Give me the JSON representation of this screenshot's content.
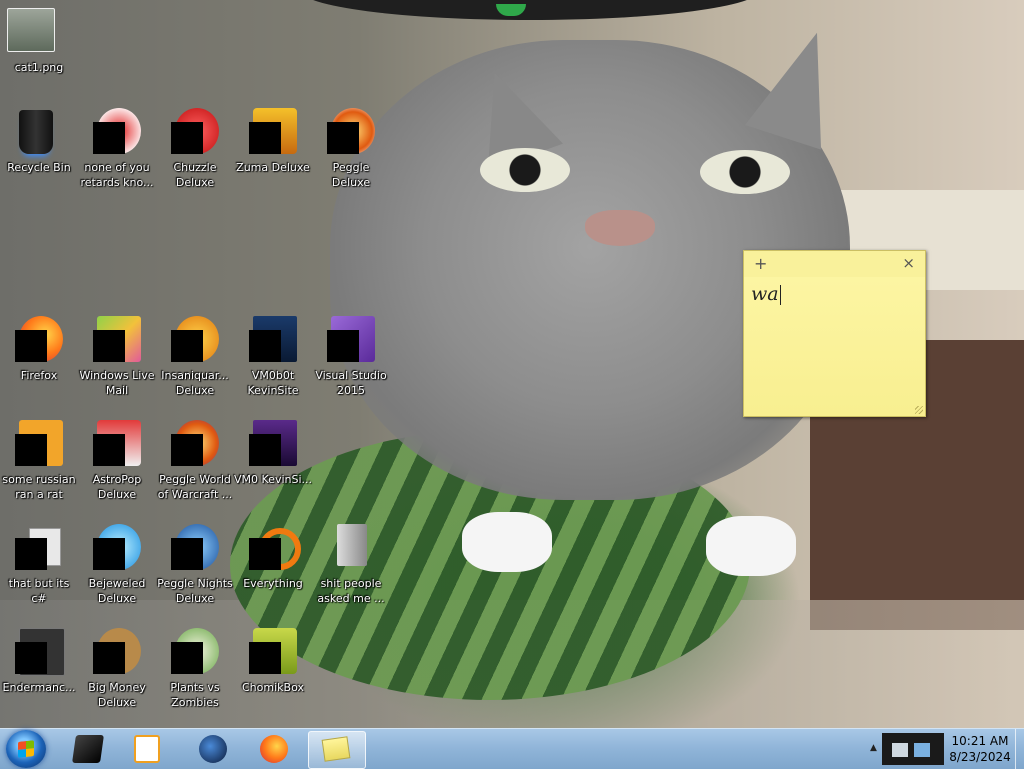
{
  "desktop": {
    "icons": [
      {
        "label": "cat1.png",
        "name": "desktop-icon-cat1"
      },
      {
        "label": "Recycle Bin",
        "name": "desktop-icon-recycle-bin"
      },
      {
        "label": "none of you retards kno...",
        "name": "desktop-icon-none-of-you"
      },
      {
        "label": "Chuzzle Deluxe",
        "name": "desktop-icon-chuzzle-deluxe"
      },
      {
        "label": "Zuma Deluxe",
        "name": "desktop-icon-zuma-deluxe"
      },
      {
        "label": "Peggle Deluxe",
        "name": "desktop-icon-peggle-deluxe"
      },
      {
        "label": "Firefox",
        "name": "desktop-icon-firefox"
      },
      {
        "label": "Windows Live Mail",
        "name": "desktop-icon-windows-live-mail"
      },
      {
        "label": "Insaniquar... Deluxe",
        "name": "desktop-icon-insaniquarium"
      },
      {
        "label": "VM0b0t KevinSite",
        "name": "desktop-icon-vm0b0t"
      },
      {
        "label": "Visual Studio 2015",
        "name": "desktop-icon-visual-studio"
      },
      {
        "label": "some russian ran a rat",
        "name": "desktop-icon-some-russian"
      },
      {
        "label": "AstroPop Deluxe",
        "name": "desktop-icon-astropop"
      },
      {
        "label": "Peggle World of Warcraft ...",
        "name": "desktop-icon-peggle-wow"
      },
      {
        "label": "VM0 KevinSi...",
        "name": "desktop-icon-vm0"
      },
      {
        "label": "that but its c#",
        "name": "desktop-icon-that-but-its-cs"
      },
      {
        "label": "Bejeweled Deluxe",
        "name": "desktop-icon-bejeweled"
      },
      {
        "label": "Peggle Nights Deluxe",
        "name": "desktop-icon-peggle-nights"
      },
      {
        "label": "Everything",
        "name": "desktop-icon-everything"
      },
      {
        "label": "shit people asked me ...",
        "name": "desktop-icon-shit-people"
      },
      {
        "label": "Endermanc...",
        "name": "desktop-icon-endermanch"
      },
      {
        "label": "Big Money Deluxe",
        "name": "desktop-icon-big-money"
      },
      {
        "label": "Plants vs Zombies",
        "name": "desktop-icon-plants-vs-zombies"
      },
      {
        "label": "ChomikBox",
        "name": "desktop-icon-chomikbox"
      }
    ]
  },
  "sticky_note": {
    "add_glyph": "+",
    "close_glyph": "×",
    "text": "wa"
  },
  "taskbar": {
    "pinned": [
      {
        "name": "taskbar-cmd",
        "icon": "terminal-icon"
      },
      {
        "name": "taskbar-media-player",
        "icon": "media-player-icon"
      },
      {
        "name": "taskbar-browser",
        "icon": "globe-icon"
      },
      {
        "name": "taskbar-firefox",
        "icon": "firefox-icon"
      },
      {
        "name": "taskbar-sticky-notes",
        "icon": "sticky-notes-icon"
      }
    ],
    "clock": {
      "time": "10:21 AM",
      "date": "8/23/2024"
    },
    "tray_arrow": "▲"
  },
  "colors": {
    "taskbar": "#8fb4d8",
    "sticky": "#fdf6a6",
    "redaction": "#000000"
  }
}
